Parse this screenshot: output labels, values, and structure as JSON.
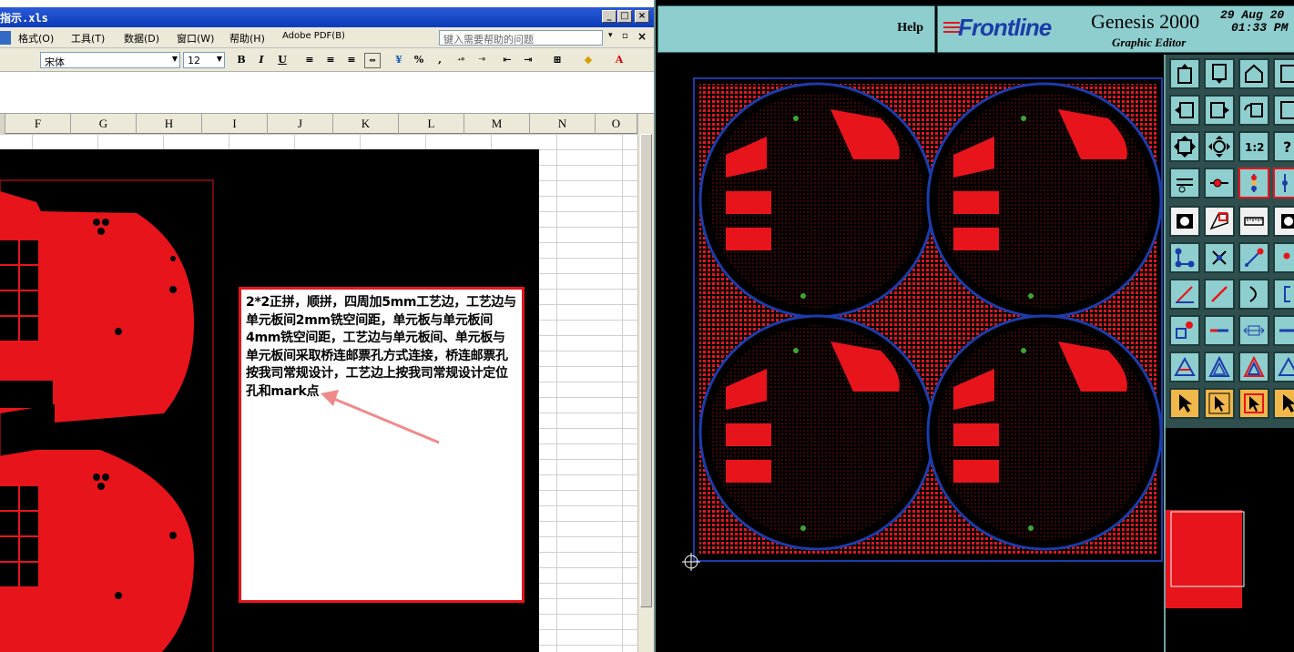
{
  "excel": {
    "title": "指示.xls",
    "window_controls": [
      "_",
      "□",
      "×"
    ],
    "menu": [
      "格式(O)",
      "工具(T)",
      "数据(D)",
      "窗口(W)",
      "帮助(H)",
      "Adobe PDF(B)"
    ],
    "ask_placeholder": "键入需要帮助的问题",
    "font_name": "宋体",
    "font_size": "12",
    "format_buttons": [
      "B",
      "I",
      "U"
    ],
    "percent": "%",
    "columns": [
      "F",
      "G",
      "H",
      "I",
      "J",
      "K",
      "L",
      "M",
      "N",
      "O"
    ],
    "note_text": "2*2正拼，顺拼，四周加5mm工艺边，工艺边与单元板间2mm铣空间距，单元板与单元板间4mm铣空间距，工艺边与单元板间、单元板与单元板间采取桥连邮票孔方式连接，桥连邮票孔按我司常规设计，工艺边上按我司常规设计定位孔和mark点"
  },
  "genesis": {
    "help_label": "Help",
    "logo": "Frontline",
    "product": "Genesis 2000",
    "subtitle": "Graphic Editor",
    "date_line1": "29 Aug 20",
    "date_line2": "01:33 PM",
    "colors": {
      "panel": "#8ecece",
      "copper": "#e8141b",
      "outline": "#1c3caa"
    }
  }
}
